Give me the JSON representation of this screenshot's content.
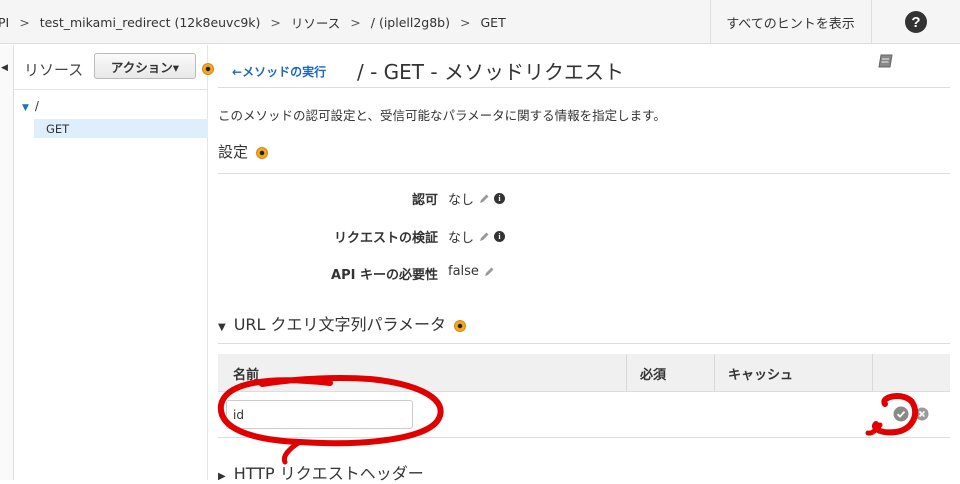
{
  "breadcrumb": {
    "items": [
      "PI",
      "test_mikami_redirect (12k8euvc9k)",
      "リソース",
      "/ (iplell2g8b)",
      "GET"
    ],
    "separator": ">"
  },
  "topbar": {
    "hints_label": "すべてのヒントを表示",
    "help_label": "?"
  },
  "resources": {
    "title": "リソース",
    "action_label": "アクション▾",
    "tree_root": "/",
    "tree_method": "GET"
  },
  "header": {
    "back_label": "メソッドの実行",
    "title": "/ - GET - メソッドリクエスト"
  },
  "description": "このメソッドの認可設定と、受信可能なパラメータに関する情報を指定します。",
  "settings": {
    "heading": "設定",
    "auth_label": "認可",
    "auth_value": "なし",
    "validation_label": "リクエストの検証",
    "validation_value": "なし",
    "apikey_label": "API キーの必要性",
    "apikey_value": "false"
  },
  "url_params": {
    "heading": "URL クエリ文字列パラメータ",
    "columns": [
      "名前",
      "必須",
      "キャッシュ"
    ],
    "row_value": "id"
  },
  "http_headers": {
    "heading": "HTTP リクエストヘッダー"
  },
  "colors": {
    "accent_link": "#1a66c2",
    "tree_selected": "#dfeefb",
    "hint_dot": "#f5a623",
    "annotation_red": "#e00000"
  }
}
